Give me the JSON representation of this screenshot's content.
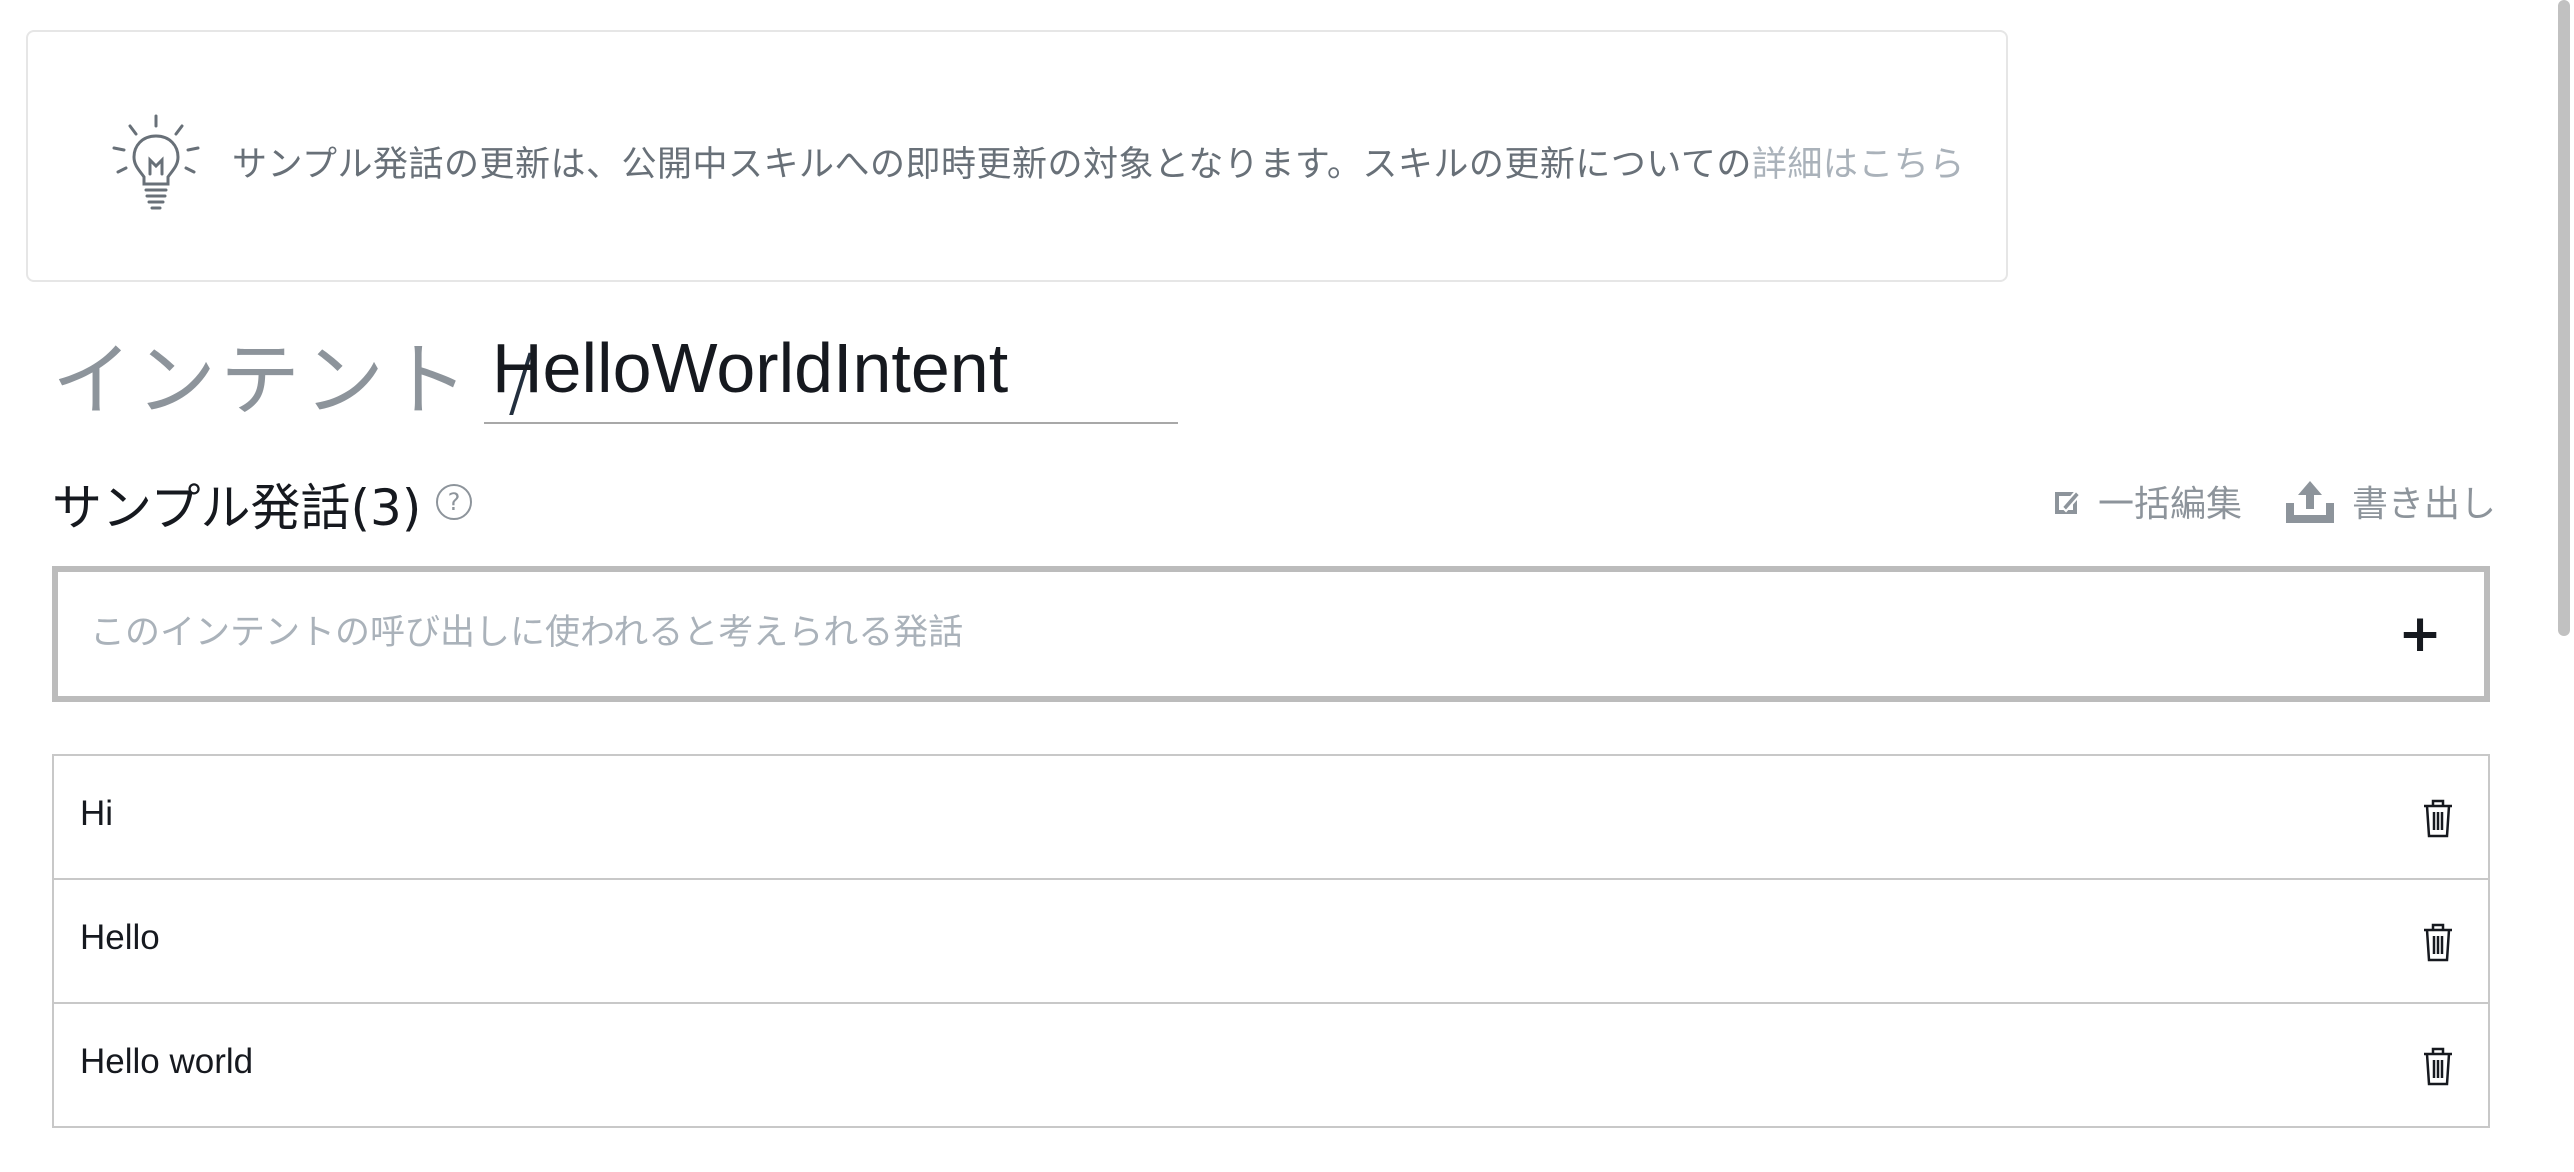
{
  "banner": {
    "icon": "lightbulb-icon",
    "text": "サンプル発話の更新は、公開中スキルへの即時更新の対象となります。スキルの更新についての",
    "link_label": "詳細はこちら"
  },
  "intent": {
    "breadcrumb_label": "インテント",
    "separator": "/",
    "name": "HelloWorldIntent"
  },
  "utterances_section": {
    "title": "サンプル発話(3)",
    "help_icon": "help-icon",
    "help_glyph": "?",
    "bulk_edit_label": "一括編集",
    "export_label": "書き出し"
  },
  "utterance_input": {
    "placeholder": "このインテントの呼び出しに使われると考えられる発話",
    "value": "",
    "add_glyph": "+"
  },
  "utterances": [
    {
      "text": "Hi"
    },
    {
      "text": "Hello"
    },
    {
      "text": "Hello world"
    }
  ],
  "colors": {
    "text_primary": "#16191f",
    "text_muted": "#8d949b",
    "link_muted": "#aab2ba",
    "border": "#c8c8c8",
    "input_border": "#bcbcbc"
  }
}
